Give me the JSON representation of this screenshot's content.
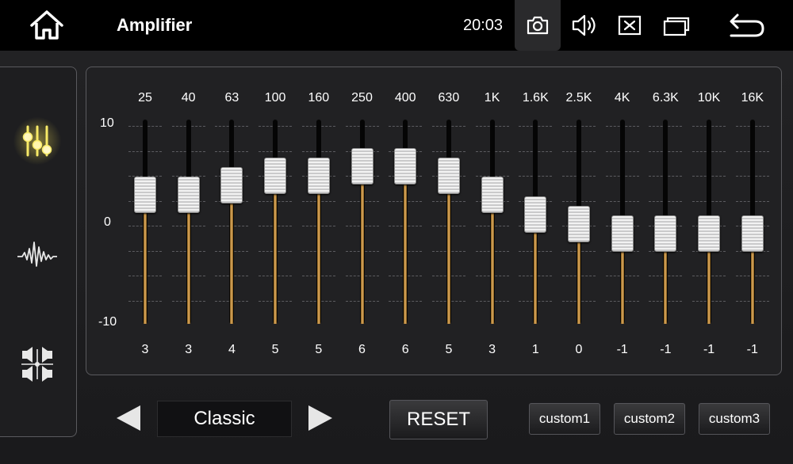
{
  "topbar": {
    "title": "Amplifier",
    "time": "20:03",
    "icons": [
      "home-icon",
      "camera-icon",
      "volume-icon",
      "close-box-icon",
      "recent-apps-icon",
      "back-icon"
    ]
  },
  "sidebar": {
    "items": [
      {
        "icon": "equalizer-sliders-icon",
        "active": true
      },
      {
        "icon": "sound-wave-icon",
        "active": false
      },
      {
        "icon": "speaker-balance-icon",
        "active": false
      }
    ]
  },
  "equalizer": {
    "scale": {
      "max": "10",
      "mid": "0",
      "min": "-10"
    },
    "range": [
      -10,
      10
    ],
    "bands": [
      {
        "freq": "25",
        "value": 3
      },
      {
        "freq": "40",
        "value": 3
      },
      {
        "freq": "63",
        "value": 4
      },
      {
        "freq": "100",
        "value": 5
      },
      {
        "freq": "160",
        "value": 5
      },
      {
        "freq": "250",
        "value": 6
      },
      {
        "freq": "400",
        "value": 6
      },
      {
        "freq": "630",
        "value": 5
      },
      {
        "freq": "1K",
        "value": 3
      },
      {
        "freq": "1.6K",
        "value": 1
      },
      {
        "freq": "2.5K",
        "value": 0
      },
      {
        "freq": "4K",
        "value": -1
      },
      {
        "freq": "6.3K",
        "value": -1
      },
      {
        "freq": "10K",
        "value": -1
      },
      {
        "freq": "16K",
        "value": -1
      }
    ]
  },
  "preset": {
    "current": "Classic"
  },
  "buttons": {
    "reset": "RESET",
    "custom1": "custom1",
    "custom2": "custom2",
    "custom3": "custom3"
  },
  "colors": {
    "accent_fill": "#e6b062",
    "active_glow": "#ffeb5a",
    "background": "#1d1d1f"
  }
}
